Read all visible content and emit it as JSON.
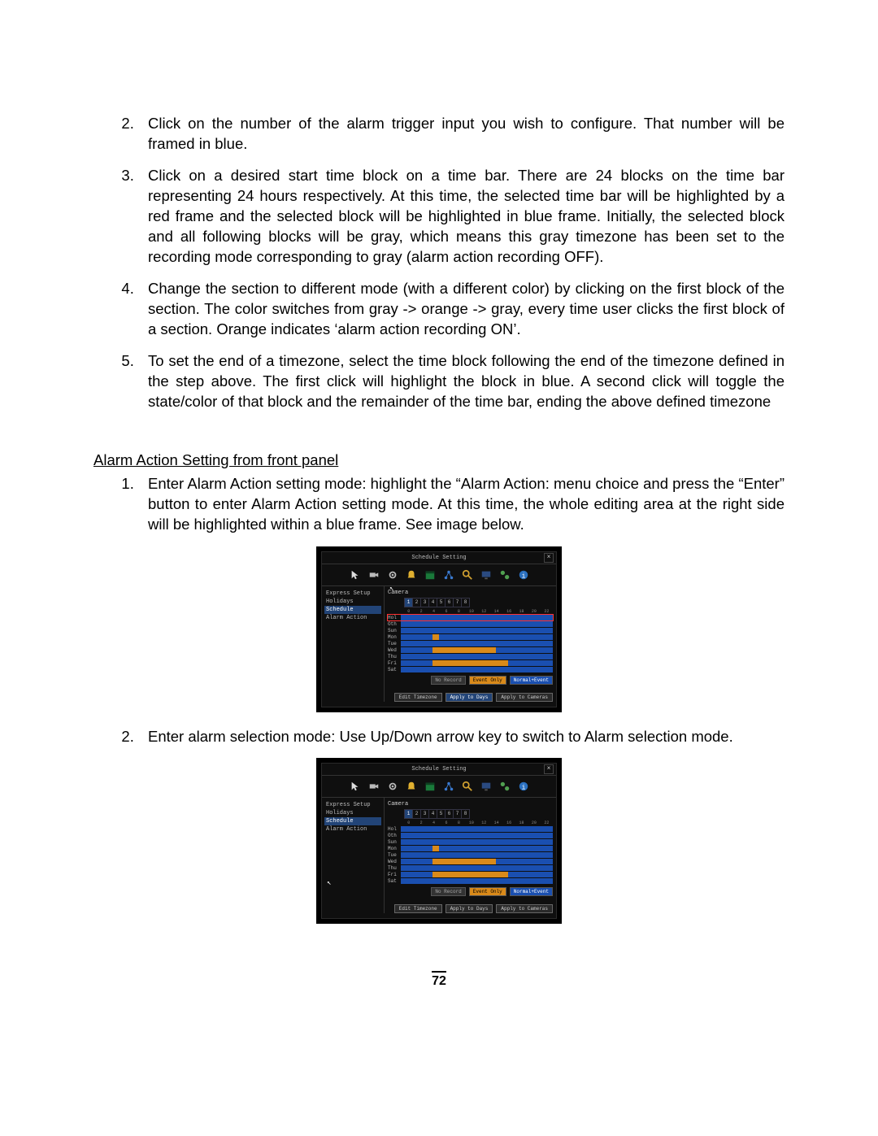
{
  "list1": {
    "items": [
      "Click on the number of the alarm trigger input you wish to configure.  That number will be framed in blue.",
      "Click on a desired start time block on a time bar. There are 24 blocks on the time bar representing 24 hours respectively. At this time, the selected time bar will be highlighted by a red frame and the selected block will be highlighted in blue frame. Initially, the selected block and all following blocks will be gray, which means this gray timezone has been set to the recording mode corresponding to gray (alarm action recording OFF).",
      "Change the section to different mode (with a different color) by clicking on the first block of the section. The color switches from gray -> orange -> gray, every time user clicks the first block of a section. Orange indicates ‘alarm action recording ON’.",
      "To set the end of a timezone, select the time block following the end of the timezone defined in the step above. The first click will highlight the block in blue. A second click will toggle the state/color of that block and the remainder of the time bar, ending the above defined timezone"
    ]
  },
  "heading2": "Alarm Action Setting from front panel",
  "list2": {
    "items": [
      "Enter Alarm Action setting mode: highlight the “Alarm Action: menu choice and press the “Enter” button to enter Alarm Action setting mode. At this time, the whole editing area at the right side will be highlighted within a blue frame. See image below.",
      "Enter alarm selection mode: Use Up/Down arrow key to switch to Alarm selection mode."
    ]
  },
  "dvr": {
    "title": "Schedule Setting",
    "side": [
      "Express Setup",
      "Holidays",
      "Schedule",
      "Alarm Action"
    ],
    "camera_label": "Camera",
    "camera_nums": [
      "1",
      "2",
      "3",
      "4",
      "5",
      "6",
      "7",
      "8"
    ],
    "days": [
      "Hol",
      "Oth",
      "Sun",
      "Mon",
      "Tue",
      "Wed",
      "Thu",
      "Fri",
      "Sat"
    ],
    "legend": {
      "no_record": "No Record",
      "event_only": "Event Only",
      "normal_event": "Normal+Event"
    },
    "buttons": {
      "edit": "Edit Timezone",
      "apply_days": "Apply to Days",
      "apply_cameras": "Apply to Cameras"
    }
  },
  "page_number": "72"
}
